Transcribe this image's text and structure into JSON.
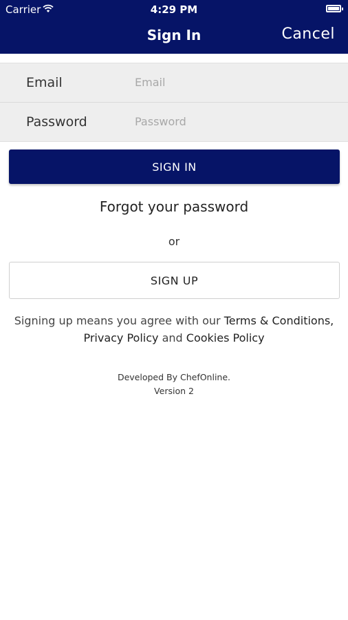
{
  "status_bar": {
    "carrier": "Carrier",
    "time": "4:29 PM",
    "wifi_icon": "wifi-icon",
    "battery_icon": "battery-icon"
  },
  "nav": {
    "title": "Sign In",
    "cancel_label": "Cancel"
  },
  "form": {
    "email_label": "Email",
    "email_placeholder": "Email",
    "email_value": "",
    "password_label": "Password",
    "password_placeholder": "Password",
    "password_value": ""
  },
  "actions": {
    "sign_in_label": "SIGN IN",
    "forgot_label": "Forgot your password",
    "or_text": "or",
    "sign_up_label": "SIGN UP"
  },
  "legal": {
    "prefix": "Signing up means you agree with our ",
    "terms_link": "Terms & Conditions,",
    "privacy_link": "Privacy Policy",
    "and_text": " and ",
    "cookies_link": "Cookies Policy"
  },
  "footer": {
    "developed_by": "Developed By ChefOnline.",
    "version": "Version 2"
  },
  "colors": {
    "primary": "#061467",
    "form_background": "#eeeeee",
    "placeholder": "#a8a8a8"
  }
}
